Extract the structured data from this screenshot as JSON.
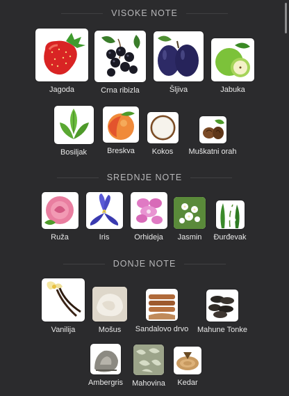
{
  "sections": {
    "top": {
      "title": "VISOKE NOTE",
      "items": [
        "Jagoda",
        "Crna ribizla",
        "Šljiva",
        "Jabuka",
        "Bosiljak",
        "Breskva",
        "Kokos",
        "Muškatni orah"
      ]
    },
    "middle": {
      "title": "SREDNJE NOTE",
      "items": [
        "Ruža",
        "Iris",
        "Orhideja",
        "Jasmin",
        "Đurđevak"
      ]
    },
    "base": {
      "title": "DONJE NOTE",
      "items": [
        "Vanilija",
        "Mošus",
        "Sandalovo drvo",
        "Mahune Tonke",
        "Ambergris",
        "Mahovina",
        "Kedar"
      ]
    }
  },
  "icons": [
    "strawberry-icon",
    "blackcurrant-icon",
    "plum-icon",
    "apple-icon",
    "basil-icon",
    "peach-icon",
    "coconut-icon",
    "nutmeg-icon",
    "rose-icon",
    "iris-icon",
    "orchid-icon",
    "jasmine-icon",
    "lily-of-the-valley-icon",
    "vanilla-icon",
    "musk-icon",
    "sandalwood-icon",
    "tonka-bean-icon",
    "ambergris-icon",
    "moss-icon",
    "cedar-icon"
  ]
}
